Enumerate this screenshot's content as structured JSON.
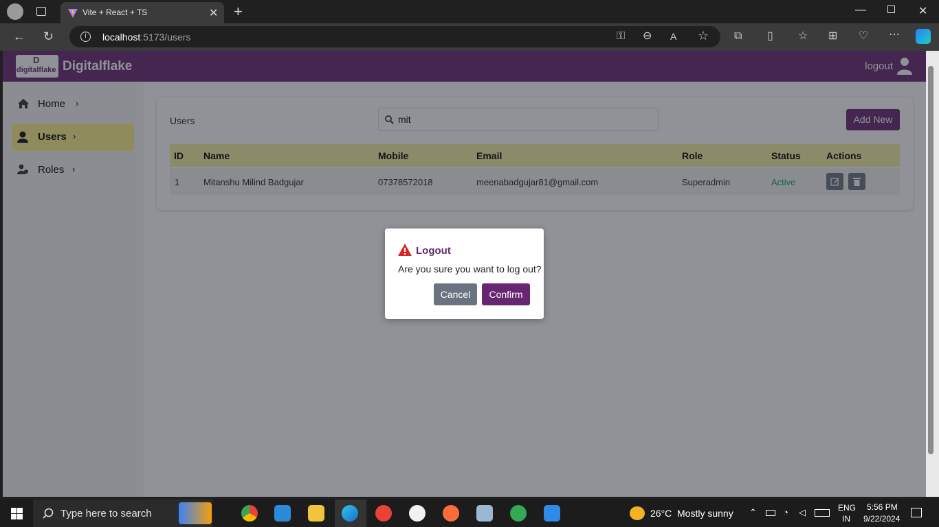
{
  "browser": {
    "tab_title": "Vite + React + TS",
    "url_host": "localhost",
    "url_path": ":5173/users"
  },
  "app": {
    "logo_text": "digitalflake",
    "logo_letter": "D",
    "brand": "Digitalflake",
    "logout_label": "logout",
    "accent_color": "#662671",
    "highlight_color": "#fef08a"
  },
  "sidebar": {
    "items": [
      {
        "label": "Home",
        "icon": "home-icon"
      },
      {
        "label": "Users",
        "icon": "user-icon"
      },
      {
        "label": "Roles",
        "icon": "roles-icon"
      }
    ]
  },
  "main": {
    "title": "Users",
    "search_value": "mit",
    "add_new_label": "Add New",
    "columns": [
      "ID",
      "Name",
      "Mobile",
      "Email",
      "Role",
      "Status",
      "Actions"
    ],
    "rows": [
      {
        "id": "1",
        "name": "Mitanshu Milind Badgujar",
        "mobile": "07378572018",
        "email": "meenabadgujar81@gmail.com",
        "role": "Superadmin",
        "status": "Active"
      }
    ]
  },
  "dialog": {
    "title": "Logout",
    "message": "Are you sure you want to log out?",
    "cancel_label": "Cancel",
    "confirm_label": "Confirm"
  },
  "taskbar": {
    "search_placeholder": "Type here to search",
    "weather_temp": "26°C",
    "weather_text": "Mostly sunny",
    "lang": "ENG",
    "region": "IN",
    "time": "5:56 PM",
    "date": "9/22/2024"
  }
}
